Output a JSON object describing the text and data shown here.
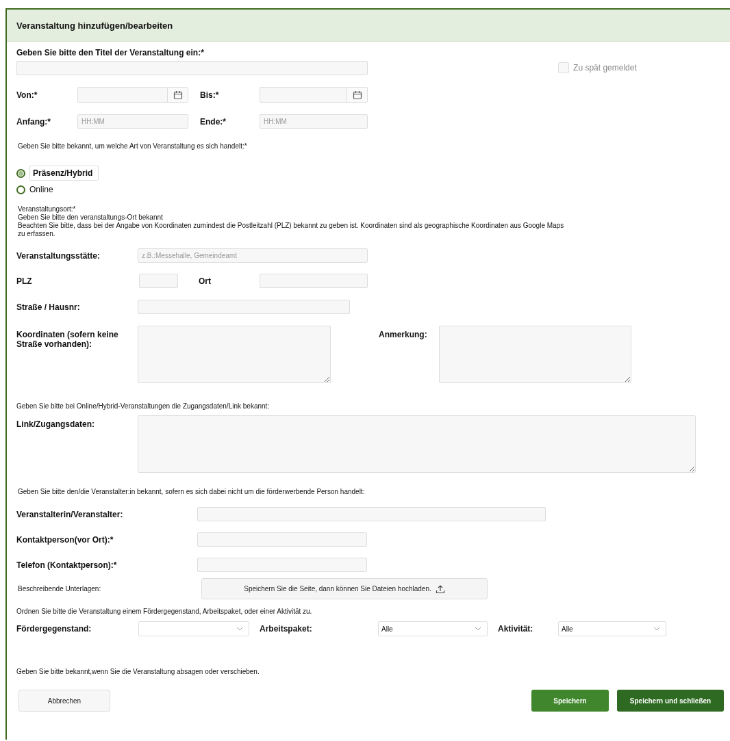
{
  "dialog": {
    "title": "Veranstaltung hinzufügen/bearbeiten"
  },
  "title_field": {
    "label": "Geben Sie bitte den Titel der Veranstaltung ein:*"
  },
  "late_checkbox": {
    "label": "Zu spät gemeldet",
    "checked": false,
    "disabled": true
  },
  "date_fields": [
    {
      "label": "Von:*"
    },
    {
      "label": "Bis:*"
    }
  ],
  "time_fields": [
    {
      "label": "Anfang:*",
      "placeholder": "HH:MM"
    },
    {
      "label": "Ende:*",
      "placeholder": "HH:MM"
    }
  ],
  "type_prompt": "Geben Sie bitte bekannt, um welche Art von Veranstaltung es sich handelt:*",
  "type_options": [
    {
      "label": "Präsenz/Hybrid",
      "selected": true
    },
    {
      "label": "Online",
      "selected": false
    }
  ],
  "location_notes": [
    "Veranstaltungsort:*",
    "Geben Sie bitte den veranstaltungs-Ort bekannt",
    "Beachten Sie bitte, dass bei der Angabe von Koordinaten zumindest die Postleitzahl (PLZ) bekannt zu geben ist. Koordinaten sind als geographische Koordinaten aus Google Maps zu erfassen."
  ],
  "venue": {
    "label": "Veranstaltungsstätte:",
    "placeholder": "z.B.:Messehalle, Gemeindeamt"
  },
  "plz": {
    "label": "PLZ"
  },
  "ort": {
    "label": "Ort"
  },
  "street": {
    "label": "Straße / Hausnr:"
  },
  "coordinates": {
    "label": "Koordinaten (sofern keine Straße vorhanden):"
  },
  "remark": {
    "label": "Anmerkung:"
  },
  "access_prompt": "Geben Sie bitte bei Online/Hybrid-Veranstaltungen die Zugangsdaten/Link bekannt:",
  "access": {
    "label": "Link/Zugangsdaten:"
  },
  "organizer_prompt": "Geben Sie bitte den/die Veranstalter:in bekannt, sofern es sich dabei nicht um die förderwerbende Person handelt:",
  "organizer_fields": [
    {
      "label": "Veranstalterin/Veranstalter:"
    },
    {
      "label": "Kontaktperson(vor Ort):*"
    },
    {
      "label": "Telefon (Kontaktperson):*"
    }
  ],
  "documents": {
    "label": "Beschreibende Unterlagen:",
    "button": "Speichern Sie die Seite, dann können Sie Dateien hochladen."
  },
  "assign_prompt": "Ordnen Sie bitte die Veranstaltung einem Fördergegenstand, Arbeitspaket, oder einer Aktivität zu.",
  "selects": [
    {
      "label": "Fördergegenstand:"
    },
    {
      "label": "Arbeitspaket:",
      "value": "Alle"
    },
    {
      "label": "Aktivität:",
      "value": "Alle"
    }
  ],
  "cancel_prompt": "Geben Sie bitte bekannt,wenn Sie die Veranstaltung absagen oder verschieben.",
  "buttons": {
    "cancel": "Abbrechen",
    "save": "Speichern",
    "save_close": "Speichern und schließen"
  }
}
